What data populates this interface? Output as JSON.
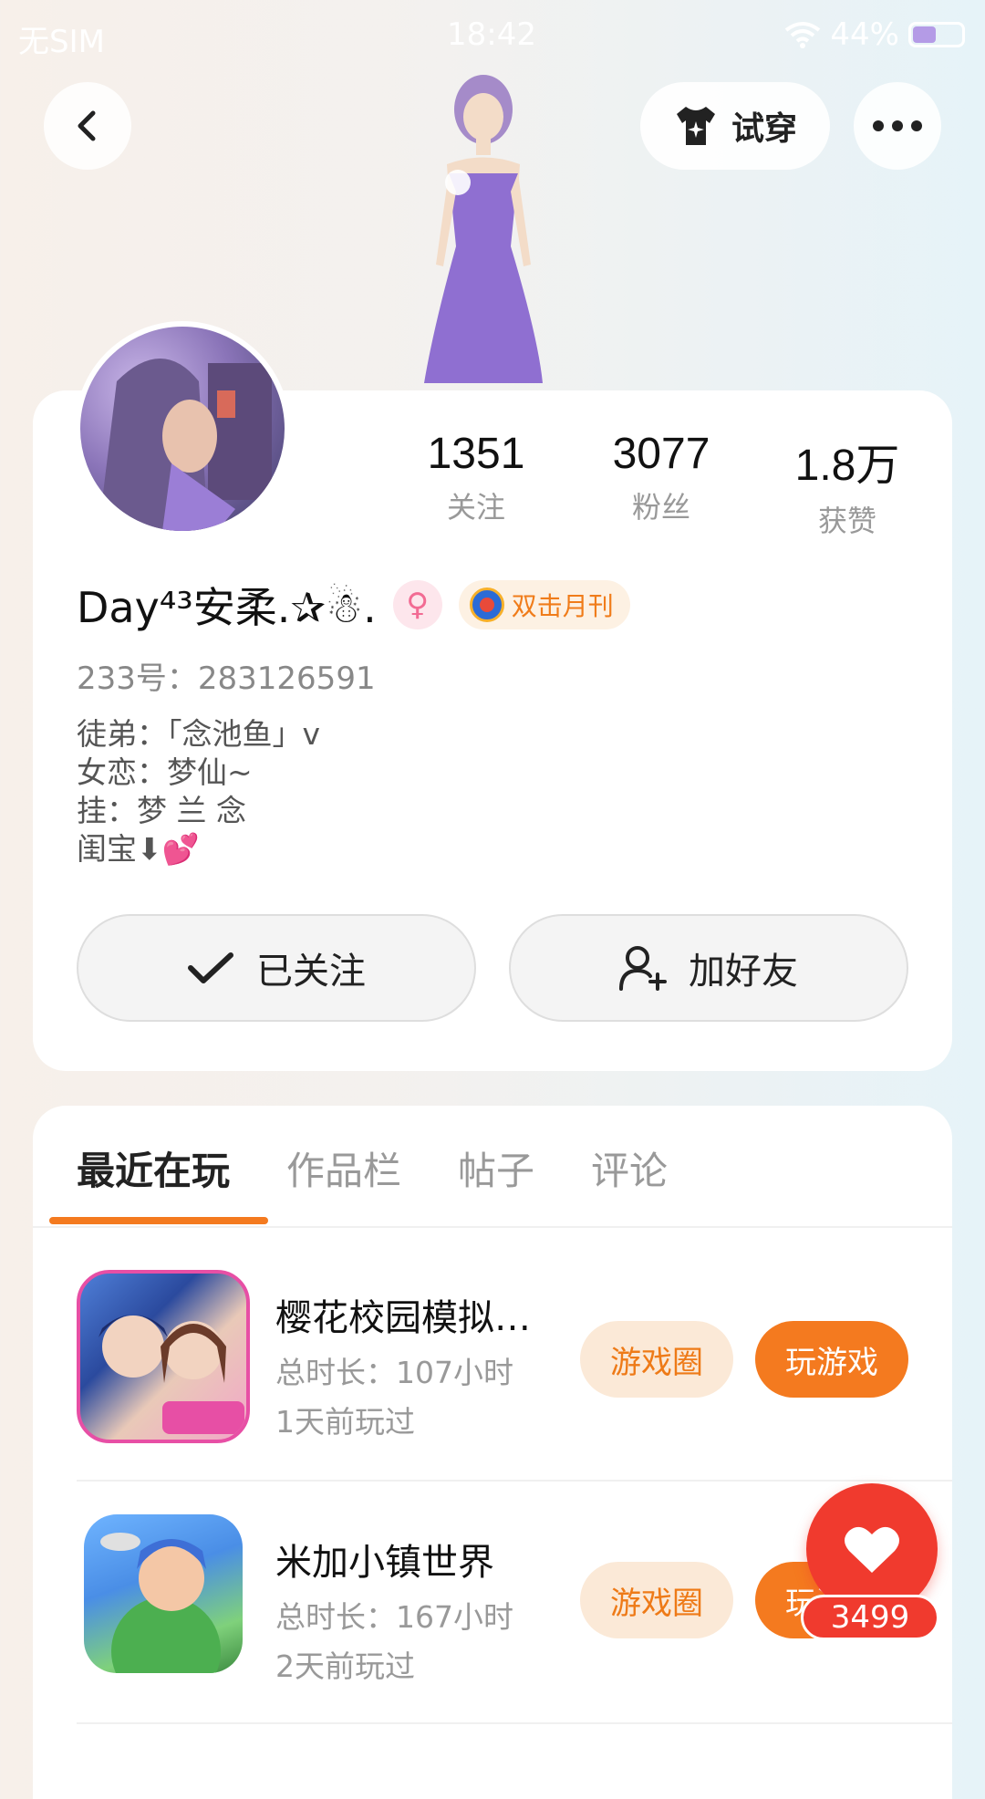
{
  "status_bar": {
    "carrier": "无SIM",
    "time": "18:42",
    "battery": "44%"
  },
  "header": {
    "try_on_label": "试穿"
  },
  "profile": {
    "stats": [
      {
        "value": "1351",
        "label": "关注"
      },
      {
        "value": "3077",
        "label": "粉丝"
      },
      {
        "value": "1.8万",
        "label": "获赞"
      }
    ],
    "nickname": "Day⁴³安柔.✰☃.",
    "gender_symbol": "♀",
    "medal_label": "双击月刊",
    "uid": "233号：283126591",
    "bio": [
      "徒弟：「念池鱼」v",
      "女恋：梦仙~",
      "挂：梦 兰 念",
      "闺宝⬇💕"
    ],
    "follow_label": "已关注",
    "add_friend_label": "加好友"
  },
  "tabs": [
    "最近在玩",
    "作品栏",
    "帖子",
    "评论"
  ],
  "games": [
    {
      "title": "樱花校园模拟…",
      "duration": "总时长：107小时",
      "last_played": "1天前玩过",
      "circle_label": "游戏圈",
      "play_label": "玩游戏"
    },
    {
      "title": "米加小镇世界",
      "duration": "总时长：167小时",
      "last_played": "2天前玩过",
      "circle_label": "游戏圈",
      "play_label": "玩游戏"
    }
  ],
  "like": {
    "count": "3499"
  },
  "colors": {
    "accent": "#f47a1f",
    "like": "#f03a2e"
  }
}
